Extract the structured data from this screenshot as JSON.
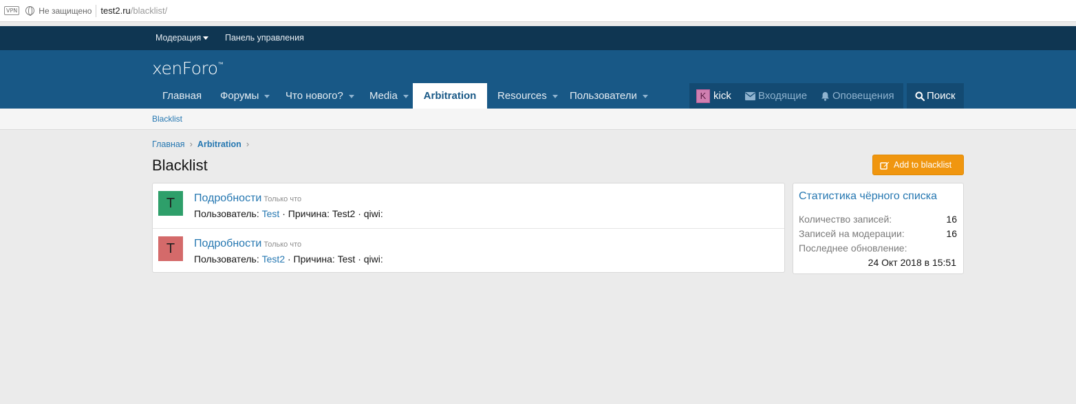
{
  "browser": {
    "vpn_label": "VPN",
    "security_text": "Не защищено",
    "url_host": "test2.ru",
    "url_path": "/blacklist/"
  },
  "staffbar": {
    "moderation_label": "Модерация",
    "control_panel_label": "Панель управления"
  },
  "logo": {
    "text": "xenForo",
    "tm": "™"
  },
  "nav": {
    "tabs": [
      {
        "label": "Главная"
      },
      {
        "label": "Форумы"
      },
      {
        "label": "Что нового?"
      },
      {
        "label": "Media"
      },
      {
        "label": "Arbitration"
      },
      {
        "label": "Resources"
      },
      {
        "label": "Пользователи"
      }
    ],
    "user_initial": "K",
    "user_name": "kick",
    "inbox_label": "Входящие",
    "alerts_label": "Оповещения",
    "search_label": "Поиск"
  },
  "subnav": {
    "blacklist_label": "Blacklist"
  },
  "breadcrumb": {
    "home": "Главная",
    "arbitration": "Arbitration"
  },
  "page": {
    "title": "Blacklist",
    "add_button_label": "Add to blacklist"
  },
  "entries": [
    {
      "avatar_initial": "T",
      "avatar_color": "#2e9f6a",
      "title": "Подробности",
      "time": "Только что",
      "user_label": "Пользователь:",
      "user": "Test",
      "reason_text": "· Причина: Test2 · qiwi:"
    },
    {
      "avatar_initial": "T",
      "avatar_color": "#d46a6a",
      "title": "Подробности",
      "time": "Только что",
      "user_label": "Пользователь:",
      "user": "Test2",
      "reason_text": "· Причина: Test · qiwi:"
    }
  ],
  "sidebar": {
    "title": "Статистика чёрного списка",
    "records_label": "Количество записей:",
    "records_value": "16",
    "moderation_label": "Записей на модерации:",
    "moderation_value": "16",
    "last_update_label": "Последнее обновление:",
    "last_update_value": "24 Окт 2018 в 15:51"
  }
}
